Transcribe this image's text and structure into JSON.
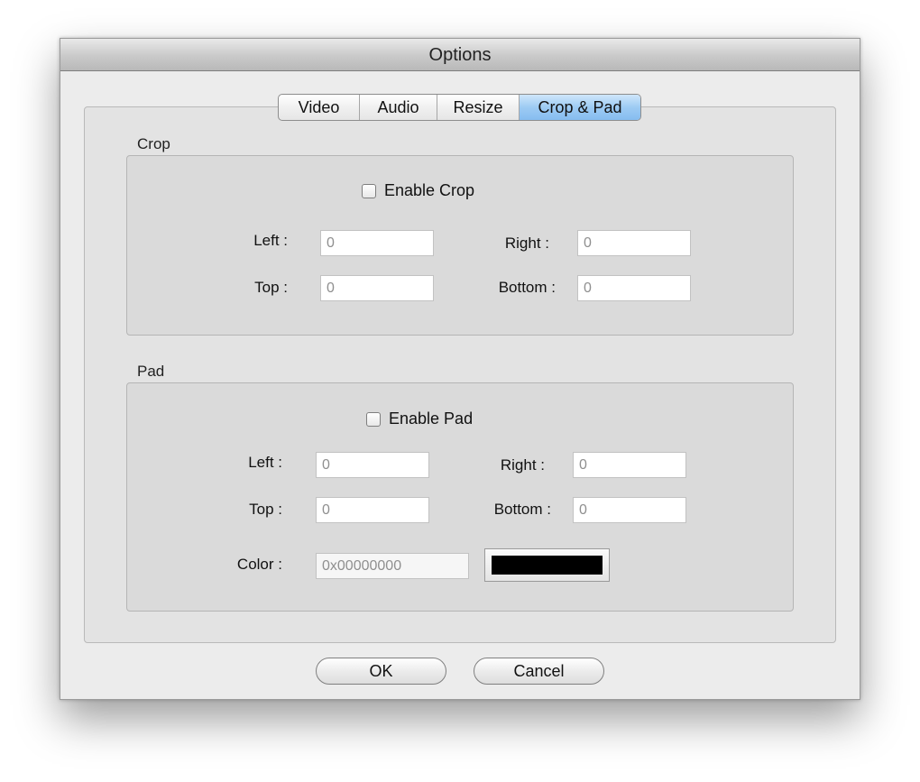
{
  "window": {
    "title": "Options"
  },
  "tabs": [
    {
      "label": "Video",
      "active": false
    },
    {
      "label": "Audio",
      "active": false
    },
    {
      "label": "Resize",
      "active": false
    },
    {
      "label": "Crop & Pad",
      "active": true
    }
  ],
  "crop": {
    "group_label": "Crop",
    "enable_label": "Enable Crop",
    "enabled": false,
    "left_label": "Left :",
    "left_value": "0",
    "right_label": "Right :",
    "right_value": "0",
    "top_label": "Top :",
    "top_value": "0",
    "bottom_label": "Bottom :",
    "bottom_value": "0"
  },
  "pad": {
    "group_label": "Pad",
    "enable_label": "Enable Pad",
    "enabled": false,
    "left_label": "Left :",
    "left_value": "0",
    "right_label": "Right :",
    "right_value": "0",
    "top_label": "Top :",
    "top_value": "0",
    "bottom_label": "Bottom :",
    "bottom_value": "0",
    "color_label": "Color :",
    "color_value": "0x00000000",
    "swatch_color": "#000000"
  },
  "buttons": {
    "ok_label": "OK",
    "cancel_label": "Cancel"
  },
  "colors": {
    "active_tab": "#9dcbf3",
    "window_bg": "#ececec",
    "group_bg": "#dadada"
  }
}
